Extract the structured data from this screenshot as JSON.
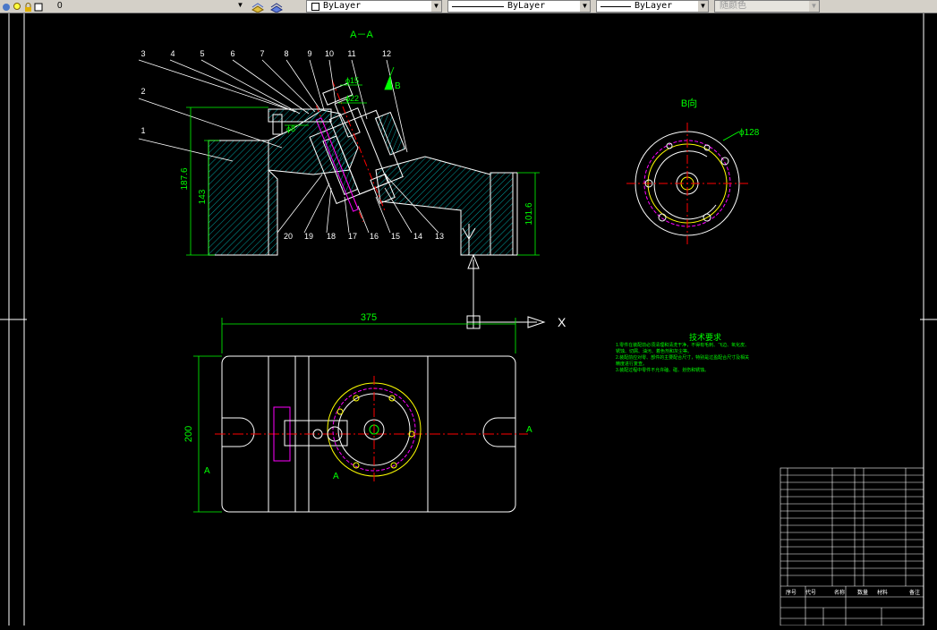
{
  "toolbar": {
    "layer_value": "0",
    "color_control": "ByLayer",
    "linetype_control": "ByLayer",
    "lineweight_control": "ByLayer",
    "plotstyle_control": "随颜色"
  },
  "drawing": {
    "section_title": "A－A",
    "view_b_title": "B向",
    "view_b_arrow_label": "B",
    "view_b_diameter": "ϕ128",
    "part_numbers_top": [
      "3",
      "4",
      "5",
      "6",
      "7",
      "8",
      "9",
      "10",
      "11",
      "12"
    ],
    "part_numbers_left": [
      "2",
      "1"
    ],
    "part_numbers_bottom": [
      "20",
      "19",
      "18",
      "17",
      "16",
      "15",
      "14",
      "13"
    ],
    "dim_height_total": "187.6",
    "dim_height_base": "143",
    "dim_height_right": "101.6",
    "dim_phi_15": "ϕ15",
    "dim_phi_22": "ϕ22",
    "dim_phi_8": "ϕ8",
    "dim_width_plan": "375",
    "dim_height_plan": "200",
    "section_marker_left": "A",
    "section_marker_right": "A",
    "section_marker_bottom": "A",
    "ucs_x_label": "X",
    "ucs_y_label": "Y",
    "tech_title": "技术要求",
    "tech_lines": [
      "1.零件在装配前必须清理和清洗干净，不得有毛刺、飞边、氧化皮、",
      "锈蚀、切屑、油污、着色剂和灰尘等。",
      "2.装配前应对零、部件的主要配合尺寸，特别是过盈配合尺寸及相关",
      "精度进行复查。",
      "3.装配过程中零件不允许磕、碰、划伤和锈蚀。"
    ]
  },
  "colors": {
    "background": "#000000",
    "outline": "#ffffff",
    "dimension": "#00ff00",
    "hatch": "#00c8c8",
    "centerline": "#ff0000",
    "hidden": "#ff00ff",
    "part": "#ffff00"
  },
  "title_block": {
    "footer_cells": [
      "序号",
      "代号",
      "名称",
      "数量",
      "材料",
      "备注"
    ]
  }
}
